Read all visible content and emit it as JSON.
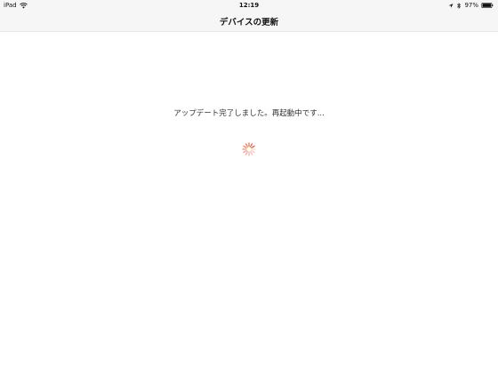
{
  "status_bar": {
    "device": "iPad",
    "time": "12:19",
    "battery_percent": "97%",
    "icons": [
      "wifi-icon",
      "location-icon",
      "bluetooth-icon",
      "battery-icon"
    ]
  },
  "nav": {
    "title": "デバイスの更新"
  },
  "content": {
    "message": "アップデート完了しました。再起動中です...",
    "spinner_color": "#e8603c"
  }
}
